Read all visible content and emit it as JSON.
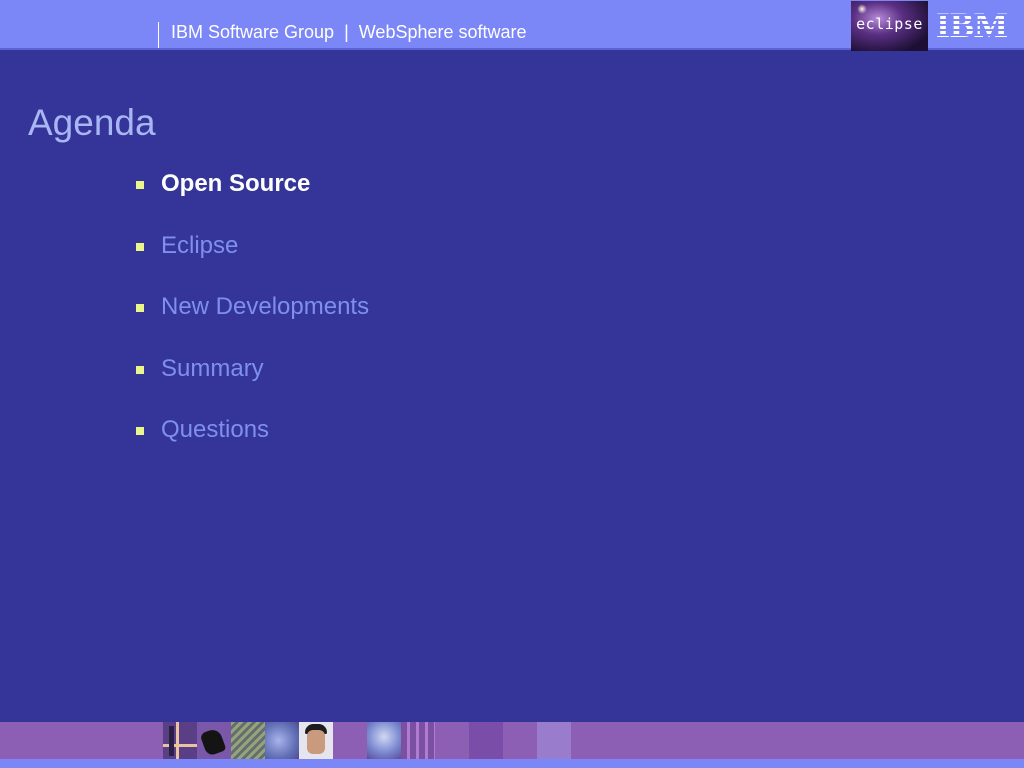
{
  "header": {
    "group": "IBM Software Group",
    "separator": "|",
    "product": "WebSphere software"
  },
  "logos": {
    "eclipse_text": "eclipse",
    "ibm_text": "IBM"
  },
  "title": "Agenda",
  "agenda": {
    "items": [
      {
        "label": "Open Source"
      },
      {
        "label": "Eclipse"
      },
      {
        "label": "New Developments"
      },
      {
        "label": "Summary"
      },
      {
        "label": "Questions"
      }
    ],
    "active_index": 0
  },
  "colors": {
    "background": "#343499",
    "header_band": "#7b86f7",
    "title": "#a9b6f4",
    "item_inactive": "#7f8ff0",
    "item_active": "#ffffff",
    "bullet": "#e8f68c",
    "footer_band": "#8c5fb4"
  }
}
